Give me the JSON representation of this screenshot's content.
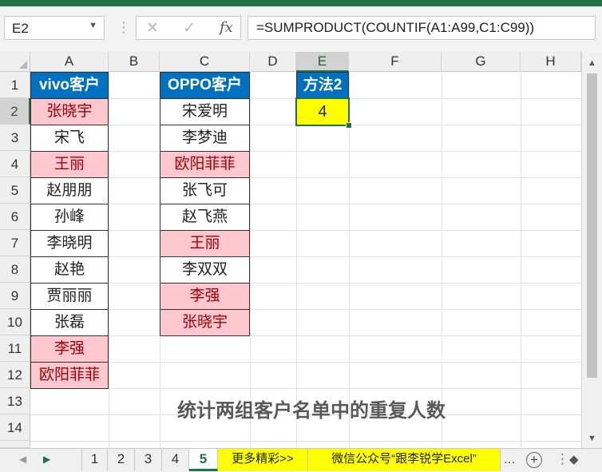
{
  "formula_bar": {
    "name_box": "E2",
    "cancel_icon": "✕",
    "enter_icon": "✓",
    "fx_label": "fx",
    "formula": "=SUMPRODUCT(COUNTIF(A1:A99,C1:C99))"
  },
  "columns": [
    "A",
    "B",
    "C",
    "D",
    "E",
    "F",
    "G",
    "H"
  ],
  "rows": [
    "1",
    "2",
    "3",
    "4",
    "5",
    "6",
    "7",
    "8",
    "9",
    "10",
    "11",
    "12",
    "13",
    "14"
  ],
  "cells": {
    "A1": "vivo客户",
    "A2": "张晓宇",
    "A3": "宋飞",
    "A4": "王丽",
    "A5": "赵朋朋",
    "A6": "孙峰",
    "A7": "李晓明",
    "A8": "赵艳",
    "A9": "贾丽丽",
    "A10": "张磊",
    "A11": "李强",
    "A12": "欧阳菲菲",
    "C1": "OPPO客户",
    "C2": "宋爱明",
    "C3": "李梦迪",
    "C4": "欧阳菲菲",
    "C5": "张飞可",
    "C6": "赵飞燕",
    "C7": "王丽",
    "C8": "李双双",
    "C9": "李强",
    "C10": "张晓宇",
    "E1": "方法2",
    "E2": "4"
  },
  "caption": "统计两组客户名单中的重复人数",
  "sheet_tabs": [
    "1",
    "2",
    "3",
    "4",
    "5",
    "更多精彩>>",
    "微信公众号“跟李锐学Excel”"
  ],
  "active_tab": "5",
  "tab_more": "...",
  "tab_add": "+",
  "colors": {
    "header_blue": "#0070c0",
    "duplicate_fill": "#ffc7ce",
    "duplicate_text": "#9c0006",
    "result_fill": "#ffff00",
    "excel_green": "#217346"
  }
}
